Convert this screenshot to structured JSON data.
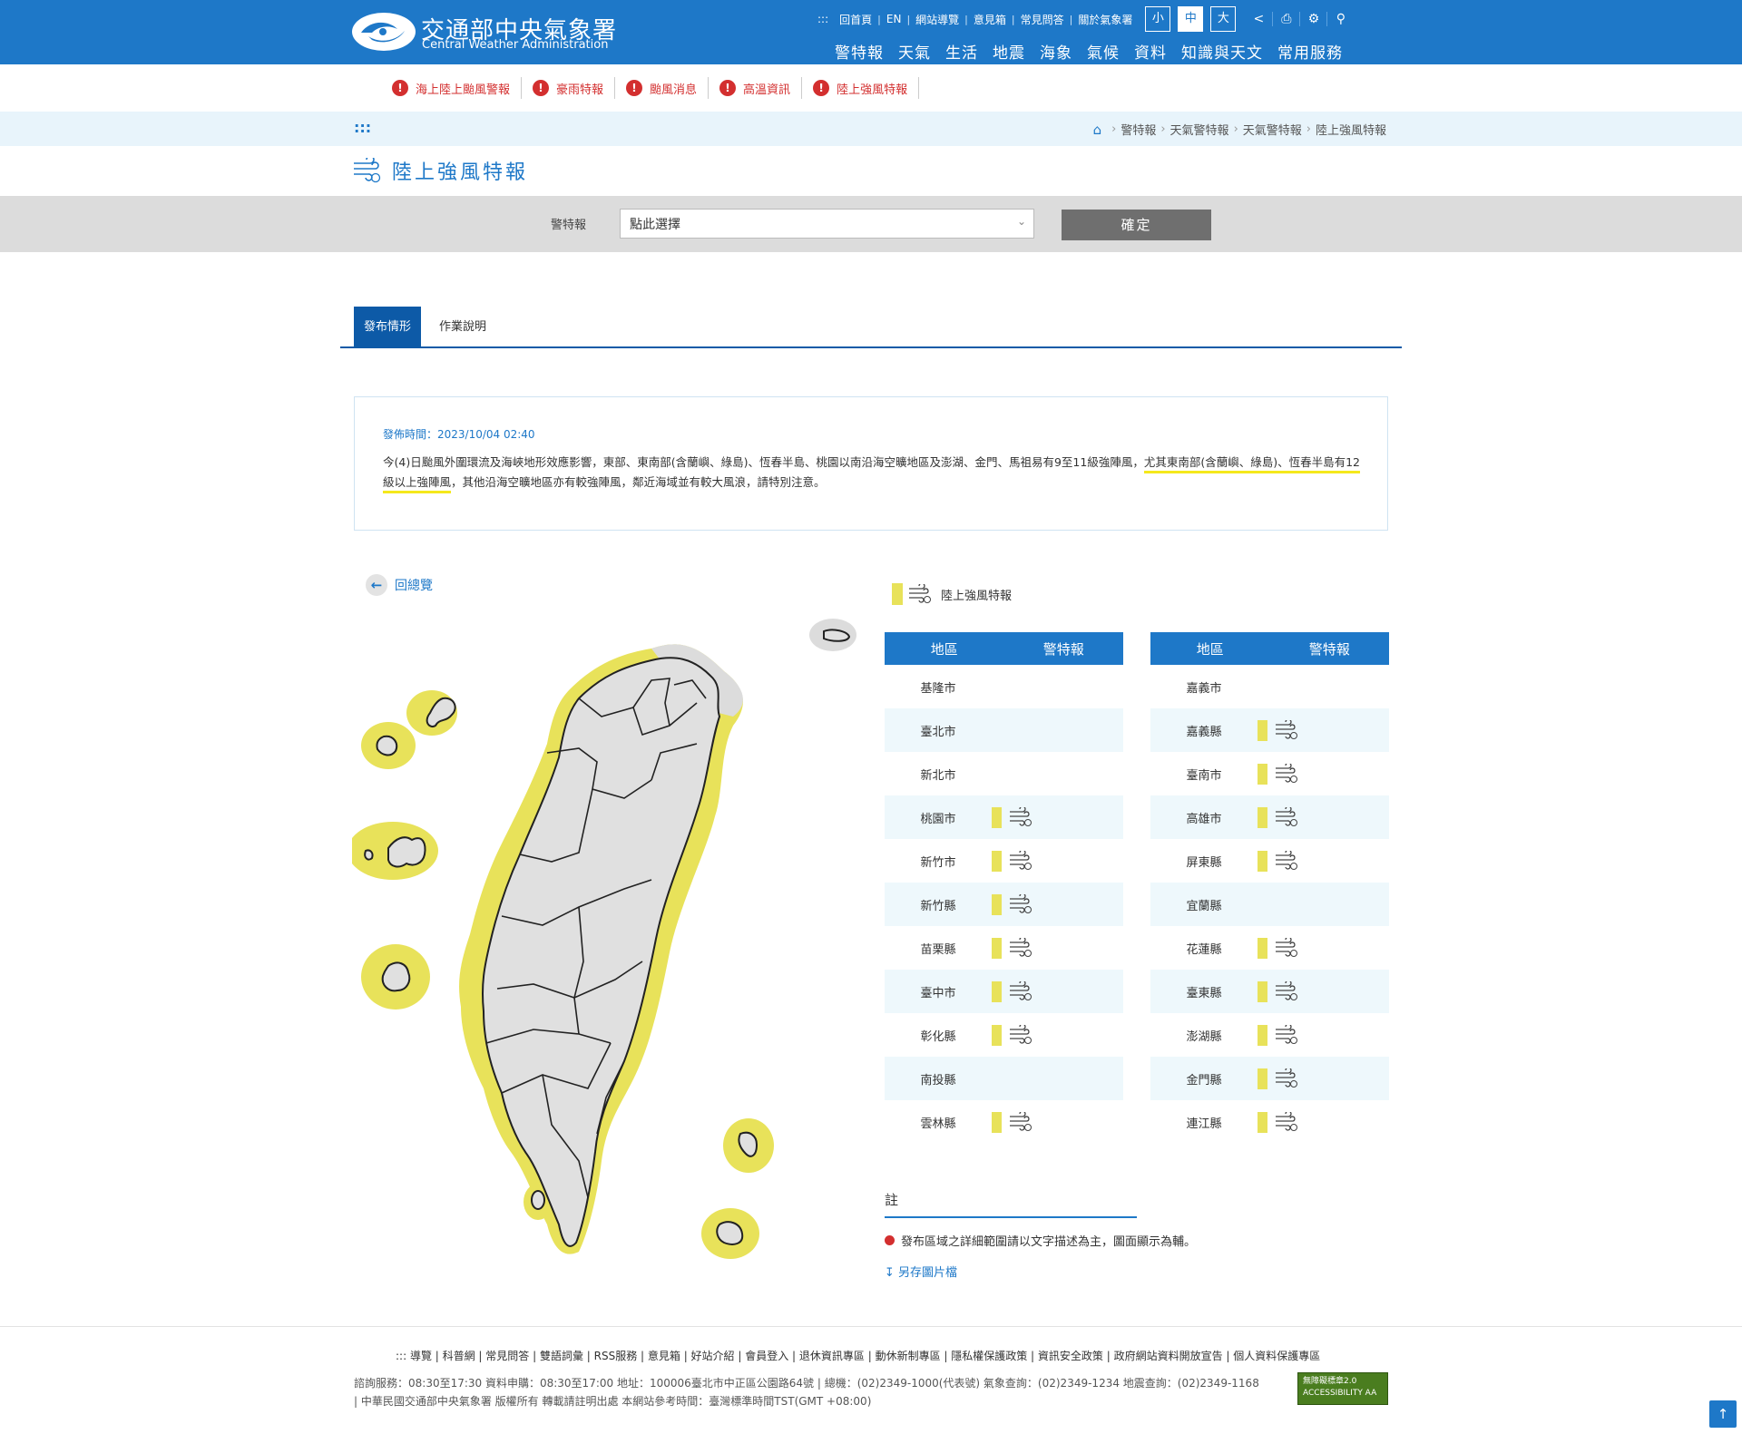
{
  "header": {
    "logo_cn": "交通部中央氣象署",
    "logo_en": "Central Weather Administration",
    "util_prefix": ":::",
    "util_links": [
      "回首頁",
      "EN",
      "網站導覽",
      "意見箱",
      "常見問答",
      "關於氣象署"
    ],
    "font_sizes": [
      "小",
      "中",
      "大"
    ],
    "main_nav": [
      "警特報",
      "天氣",
      "生活",
      "地震",
      "海象",
      "氣候",
      "資料",
      "知識與天文",
      "常用服務"
    ]
  },
  "alerts": [
    "海上陸上颱風警報",
    "豪雨特報",
    "颱風消息",
    "高溫資訊",
    "陸上強風特報"
  ],
  "breadcrumb": {
    "dots": ":::",
    "items": [
      "警特報",
      "天氣警特報",
      "天氣警特報",
      "陸上強風特報"
    ]
  },
  "page_title": "陸上強風特報",
  "selector": {
    "label": "警特報",
    "value": "點此選擇",
    "button": "確定"
  },
  "tabs": [
    "發布情形",
    "作業說明"
  ],
  "notice": {
    "time_label": "發佈時間：2023/10/04 02:40",
    "text_part1": "今(4)日颱風外圍環流及海峽地形效應影響，東部、東南部(含蘭嶼、綠島)、恆春半島、桃園以南沿海空曠地區及澎湖、金門、馬祖易有9至11級強陣風，",
    "text_underlined": "尤其東南部(含蘭嶼、綠島)、恆春半島有12級以上強陣風",
    "text_part2": "，其他沿海空曠地區亦有較強陣風，鄰近海域並有較大風浪，請特別注意。"
  },
  "back_label": "回總覽",
  "legend_label": "陸上強風特報",
  "table_headers": [
    "地區",
    "警特報"
  ],
  "left_table": [
    {
      "name": "基隆市",
      "warn": false
    },
    {
      "name": "臺北市",
      "warn": false
    },
    {
      "name": "新北市",
      "warn": false
    },
    {
      "name": "桃園市",
      "warn": true
    },
    {
      "name": "新竹市",
      "warn": true
    },
    {
      "name": "新竹縣",
      "warn": true
    },
    {
      "name": "苗栗縣",
      "warn": true
    },
    {
      "name": "臺中市",
      "warn": true
    },
    {
      "name": "彰化縣",
      "warn": true
    },
    {
      "name": "南投縣",
      "warn": false
    },
    {
      "name": "雲林縣",
      "warn": true
    }
  ],
  "right_table": [
    {
      "name": "嘉義市",
      "warn": false
    },
    {
      "name": "嘉義縣",
      "warn": true
    },
    {
      "name": "臺南市",
      "warn": true
    },
    {
      "name": "高雄市",
      "warn": true
    },
    {
      "name": "屏東縣",
      "warn": true
    },
    {
      "name": "宜蘭縣",
      "warn": false
    },
    {
      "name": "花蓮縣",
      "warn": true
    },
    {
      "name": "臺東縣",
      "warn": true
    },
    {
      "name": "澎湖縣",
      "warn": true
    },
    {
      "name": "金門縣",
      "warn": true
    },
    {
      "name": "連江縣",
      "warn": true
    }
  ],
  "note": {
    "heading": "註",
    "item1": "發布區域之詳細範圍請以文字描述為主，圖面顯示為輔。",
    "item2": "另存圖片檔"
  },
  "footer": {
    "links": "::: 導覽 | 科普網 | 常見問答 | 雙語詞彙 | RSS服務 | 意見箱 | 好站介紹 | 會員登入 | 退休資訊專區 | 動休新制專區 | 隱私權保護政策 | 資訊安全政策 | 政府網站資料開放宣告 | 個人資料保護專區",
    "info1": "諮詢服務：08:30至17:30 資料申購：08:30至17:00 地址：100006臺北市中正區公園路64號 | 總機：(02)2349-1000(代表號) 氣象查詢：(02)2349-1234 地震查詢：(02)2349-1168",
    "info2": "| 中華民國交通部中央氣象署 版權所有 轉載請註明出處 本網站參考時間：臺灣標準時間TST(GMT +08:00)",
    "badge_line1": "無障礙標章2.0",
    "badge_line2": "ACCESSIBILITY AA"
  },
  "colors": {
    "brand_blue": "#1e78c8",
    "alert_red": "#d32f2f",
    "warning_yellow": "#e8e25a"
  }
}
